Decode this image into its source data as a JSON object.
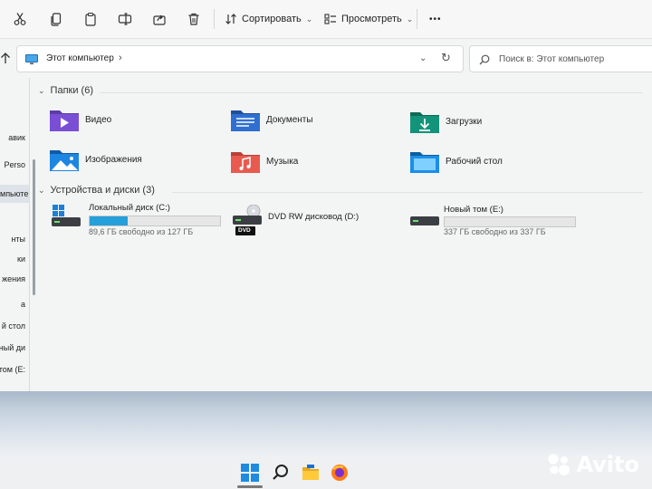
{
  "toolbar": {
    "sort_label": "Сортировать",
    "view_label": "Просмотреть",
    "more_label": "•••"
  },
  "address": {
    "path": "Этот компьютер",
    "chevron": "›",
    "dropdown": "⌄",
    "refresh": "↻"
  },
  "search": {
    "placeholder": "Поиск в: Этот компьютер"
  },
  "nav": {
    "items": [
      "авик",
      "Perso",
      "мпьютер",
      "нты",
      "ки",
      "жения",
      "а",
      "й стол",
      "льный ди",
      "й том (E:"
    ]
  },
  "folders": {
    "header": "Папки (6)",
    "items": [
      {
        "label": "Видео",
        "icon": "video-folder-icon"
      },
      {
        "label": "Документы",
        "icon": "documents-folder-icon"
      },
      {
        "label": "Загрузки",
        "icon": "downloads-folder-icon"
      },
      {
        "label": "Изображения",
        "icon": "pictures-folder-icon"
      },
      {
        "label": "Музыка",
        "icon": "music-folder-icon"
      },
      {
        "label": "Рабочий стол",
        "icon": "desktop-folder-icon"
      }
    ]
  },
  "drives": {
    "header": "Устройства и диски (3)",
    "items": [
      {
        "label": "Локальный диск (C:)",
        "free": "89,6 ГБ свободно из 127 ГБ",
        "used_fraction": 0.29
      },
      {
        "label": "DVD RW дисковод (D:)",
        "badge": "DVD"
      },
      {
        "label": "Новый том (E:)",
        "free": "337 ГБ свободно из 337 ГБ",
        "used_fraction": 0.0
      }
    ]
  },
  "watermark": {
    "text": "Avito"
  },
  "colors": {
    "accent": "#26a0da",
    "window_bg": "#f3f4f4",
    "taskbar_bg": "#eef0f2"
  }
}
